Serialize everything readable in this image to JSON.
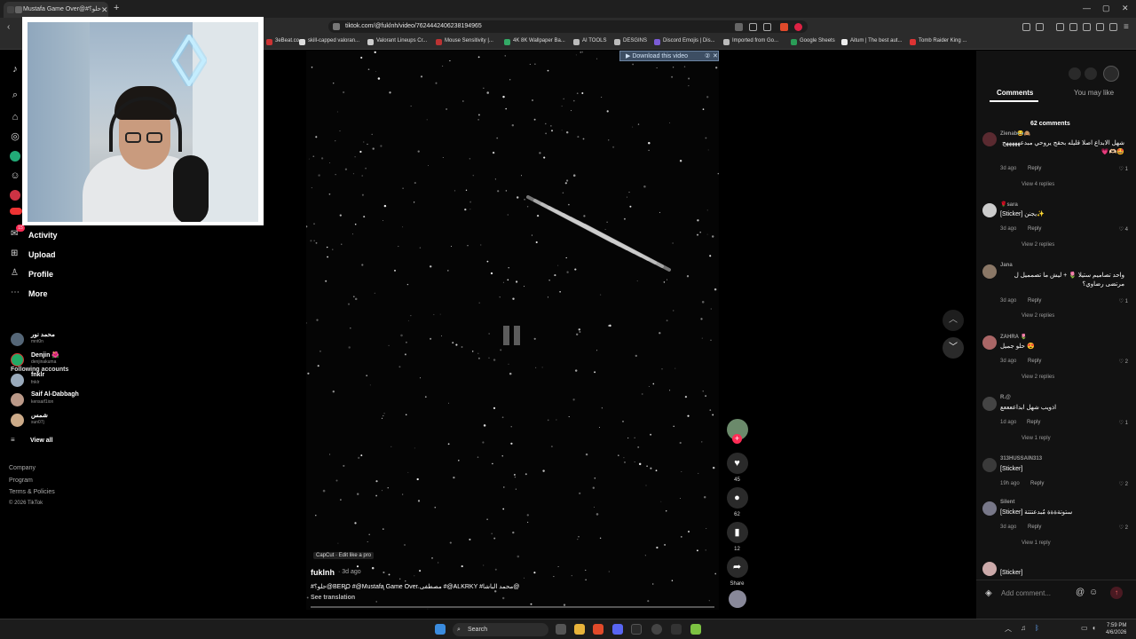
{
  "browser": {
    "tab_title": "Mustafa Game Over@#حلو؟",
    "url": "tiktok.com/@fuklnh/video/7624442406238194965",
    "bookmarks": [
      "3eBeat.co...",
      "skill-capped valoran...",
      "Valorant Lineups Cr...",
      "Mouse Sensitivity |...",
      "4K 8K Wallpaper Ba...",
      "AI TOOLS",
      "DESGINS",
      "Discord Emojis | Dis...",
      "Imported from Go...",
      "Google Sheets",
      "Aitum | The best aut...",
      "Tomb Raider King ..."
    ]
  },
  "sidebar": {
    "nav": [
      {
        "icon": "bell-icon",
        "label": "Activity"
      },
      {
        "icon": "upload-icon",
        "label": "Upload"
      },
      {
        "icon": "profile-icon",
        "label": "Profile"
      },
      {
        "icon": "more-icon",
        "label": "More"
      }
    ],
    "activity_badge": "15",
    "following_title": "Following accounts",
    "accounts": [
      {
        "name": "محمد نور",
        "handle": "mnt0n"
      },
      {
        "name": "Denjin 🌺",
        "handle": "denjinakuma"
      },
      {
        "name": "fnklr",
        "handle": "fnklr"
      },
      {
        "name": "Saif Al-Dabbagh",
        "handle": "kensaif1ion"
      },
      {
        "name": "شمس",
        "handle": "sun07j"
      }
    ],
    "view_all": "View all",
    "footer": [
      "Company",
      "Program",
      "Terms & Policies",
      "© 2026 TikTok"
    ]
  },
  "video": {
    "download_label": "Download this video",
    "capcut": "CapCut · Edit like a pro",
    "author": "fuklnh",
    "posted": "· 3d ago",
    "caption": "#حلو؟@BERO #@Mustafa Game Over مصطفى #@ALKRKY #محمد الباشا@",
    "see_translation": "See translation"
  },
  "actions": {
    "likes": "45",
    "comments": "62",
    "saves": "12",
    "share": "Share"
  },
  "panel": {
    "tab_comments": "Comments",
    "tab_you_may_like": "You may like",
    "count": "62 comments",
    "add_placeholder": "Add comment...",
    "comments": [
      {
        "name": "Zienab😂🙈",
        "text": "شهل الابداع اصلا قليله بحقج يروحي مبدعهههههج 🤩🫶🏻💗",
        "time": "3d ago",
        "likes": "1",
        "replies": "View 4 replies"
      },
      {
        "name": "🌹sara",
        "text": "[Sticker] يجنن✨",
        "time": "3d ago",
        "likes": "4",
        "replies": "View 2 replies"
      },
      {
        "name": "Jana",
        "text": "واحد تصاميم ستيلا 🌷 + ليش ما تصمميل ل مرتضى رضاوي؟",
        "time": "3d ago",
        "likes": "1",
        "replies": "View 2 replies"
      },
      {
        "name": "ZAHRA 🌷",
        "text": "حلو جميل 😍",
        "time": "3d ago",
        "likes": "2",
        "replies": "View 2 replies"
      },
      {
        "name": "R.@",
        "text": "اذويب شهل ابداععععع",
        "time": "1d ago",
        "likes": "1",
        "replies": "View 1 reply"
      },
      {
        "name": "313HUSSAIN313",
        "text": "[Sticker]",
        "time": "19h ago",
        "likes": "2",
        "replies": ""
      },
      {
        "name": "Silent",
        "text": "[Sticker] ستوتةةةة مُبدعتتتة",
        "time": "3d ago",
        "likes": "2",
        "replies": "View 1 reply"
      },
      {
        "name": "",
        "text": "[Sticker]",
        "time": "",
        "likes": "",
        "replies": ""
      }
    ],
    "reply_label": "Reply"
  },
  "taskbar": {
    "search": "Search",
    "time": "7:59 PM",
    "date": "4/6/2026"
  }
}
